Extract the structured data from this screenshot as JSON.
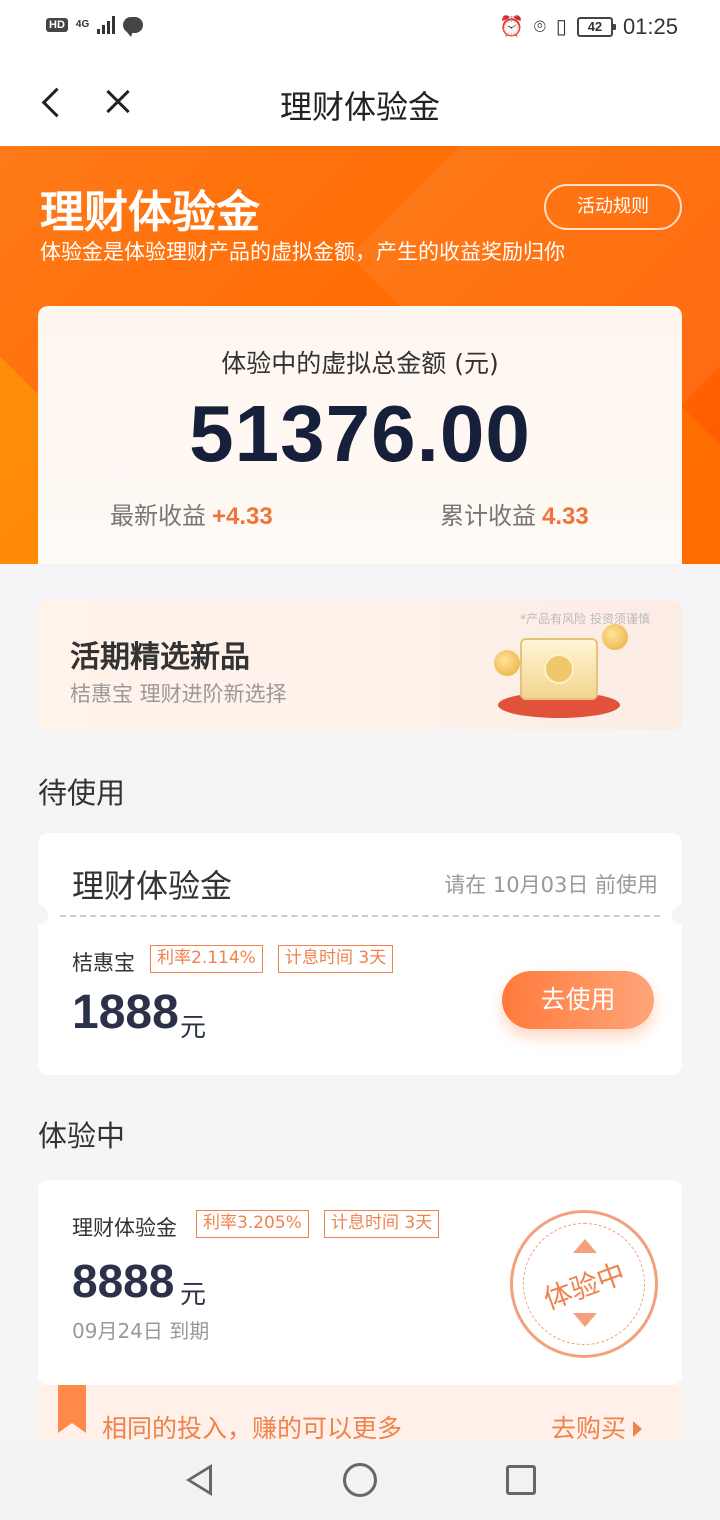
{
  "status_bar": {
    "hd": "HD",
    "network": "4G",
    "time": "01:25",
    "battery": "42",
    "icons": [
      "signal-icon",
      "message-icon",
      "alarm-icon",
      "location-icon",
      "vibrate-icon",
      "battery-icon"
    ]
  },
  "nav": {
    "title": "理财体验金",
    "back_icon": "chevron-left-icon",
    "close_icon": "close-icon"
  },
  "hero": {
    "title": "理财体验金",
    "subtitle": "体验金是体验理财产品的虚拟金额，产生的收益奖励归你",
    "rules_button": "活动规则"
  },
  "summary": {
    "label": "体验中的虚拟总金额 (元)",
    "total": "51376.00",
    "latest_label": "最新收益",
    "latest_value": "+4.33",
    "cumulative_label": "累计收益",
    "cumulative_value": "4.33"
  },
  "banner": {
    "title": "活期精选新品",
    "subtitle": "桔惠宝 理财进阶新选择",
    "note": "*产品有风险 投资须谨慎"
  },
  "pending": {
    "heading": "待使用",
    "card": {
      "title": "理财体验金",
      "deadline": "请在 10月03日 前使用",
      "product": "桔惠宝",
      "tags": [
        "利率2.114%",
        "计息时间 3天"
      ],
      "amount": "1888",
      "unit": "元",
      "button": "去使用"
    }
  },
  "active": {
    "heading": "体验中",
    "card": {
      "product": "理财体验金",
      "tags": [
        "利率3.205%",
        "计息时间 3天"
      ],
      "amount": "8888",
      "unit": "元",
      "expire": "09月24日 到期",
      "stamp": "体验中"
    }
  },
  "promo": {
    "text": "相同的投入，赚的可以更多",
    "link": "去购买"
  },
  "colors": {
    "brand_orange": "#ff6a00",
    "accent": "#f0824d",
    "dark_text": "#17203a"
  }
}
